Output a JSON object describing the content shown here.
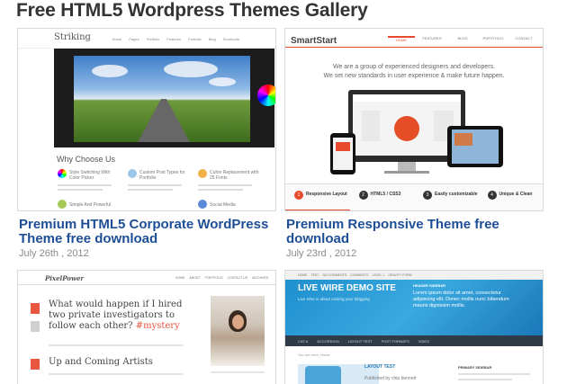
{
  "page": {
    "title": "Free HTML5 Wordpress Themes Gallery"
  },
  "posts": [
    {
      "title": "Premium HTML5 Corporate WordPress Theme free download",
      "date": "July 26th , 2012",
      "thumb": {
        "logo": "Striking",
        "nav": [
          "Home",
          "Pages",
          "Portfolio",
          "Features",
          "Portfolio",
          "Blog",
          "Shortcode"
        ],
        "heading": "Why Choose Us",
        "features": [
          "Style Switching With Color Picker",
          "Custom Post Types for Portfolio",
          "Cufon Replacement with 25 Fonts",
          "Simple And Powerful",
          "Social Media"
        ]
      }
    },
    {
      "title": "Premium Responsive Theme free download",
      "date": "July 23rd , 2012",
      "thumb": {
        "logo": "SmartStart",
        "nav": [
          "HOME",
          "FEATURES",
          "BLOG",
          "PORTFOLIO",
          "CONTACT"
        ],
        "tagline": [
          "We are a group of experienced designers and developers.",
          "We set new standards in user experience & make future happen."
        ],
        "steps": [
          "Responsive Layout",
          "HTML5 / CSS3",
          "Easily customizable",
          "Unique & Clean"
        ]
      }
    },
    {
      "title": "",
      "date": "",
      "thumb": {
        "logo": "PixelPower",
        "nav": [
          "HOME",
          "ABOUT",
          "PORTFOLIO",
          "CONTACT US",
          "ARCHIVES"
        ],
        "headline": "What would happen if I hired two private investigators to follow each other?",
        "hashtag": "#mystery",
        "subheadline": "Up and Coming Artists"
      }
    },
    {
      "title": "",
      "date": "",
      "thumb": {
        "topnav": [
          "HOME",
          "TEST",
          "NO COMMENTS",
          "COMMENTS",
          "LEVEL 1",
          "GRAVITY FORM"
        ],
        "site_title": "LIVE WIRE DEMO SITE",
        "site_sub": "Live Wire is about rocking your blogging",
        "sidebar_heading": "HEADER SIDEBAR",
        "lorem": "Lorem ipsum dolor sit amet, consectetur adipiscing elit. Donec mollis nunc bibendum mauris dignissim mollis.",
        "menu": [
          "CAT A",
          "ACCORDION",
          "LAYOUT TEST",
          "POST FORMATS",
          "VIDEO"
        ],
        "crumb": "You are here: Home",
        "post_title": "LAYOUT TEST",
        "post_meta": "Published by chip bennett",
        "primary": "PRIMARY SIDEBAR"
      }
    }
  ]
}
